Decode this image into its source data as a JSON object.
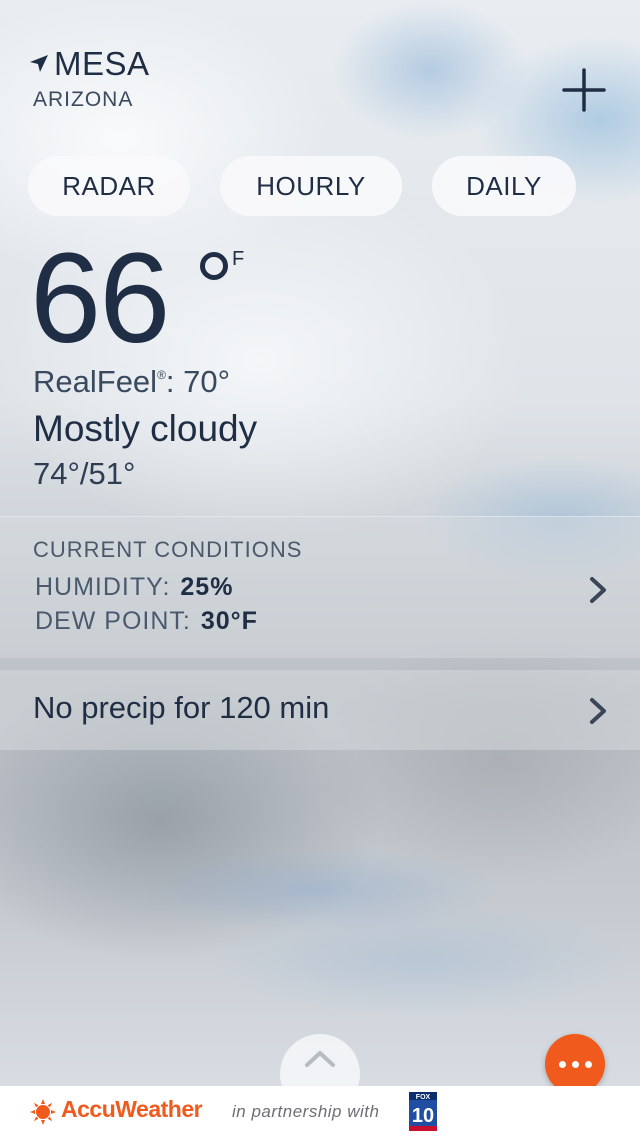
{
  "location": {
    "city": "MESA",
    "state": "ARIZONA"
  },
  "tabs": [
    {
      "label": "RADAR"
    },
    {
      "label": "HOURLY"
    },
    {
      "label": "DAILY"
    }
  ],
  "current": {
    "temperature": "66",
    "unit": "F",
    "realfeel_label": "RealFeel",
    "realfeel_mark": "®",
    "realfeel_value": ": 70°",
    "condition": "Mostly cloudy",
    "high_low": "74°/51°"
  },
  "conditions": {
    "title": "CURRENT CONDITIONS",
    "humidity_label": "HUMIDITY:",
    "humidity_value": "25%",
    "dew_point_label": "DEW POINT:",
    "dew_point_value": "30°F"
  },
  "precip": {
    "text": "No precip for 120 min"
  },
  "footer": {
    "brand": "AccuWeather",
    "partner_text": "in partnership with",
    "partner_logo_text": "10"
  },
  "icons": {
    "location": "navigation-arrow-icon",
    "add": "plus-icon",
    "chevron": "chevron-right-icon",
    "expand": "chevron-up-icon",
    "more": "more-dots-icon",
    "sun": "accuweather-sun-logo"
  },
  "colors": {
    "text_primary": "#1f2e44",
    "accent": "#f05a1c",
    "footer_bg": "#ffffff"
  }
}
